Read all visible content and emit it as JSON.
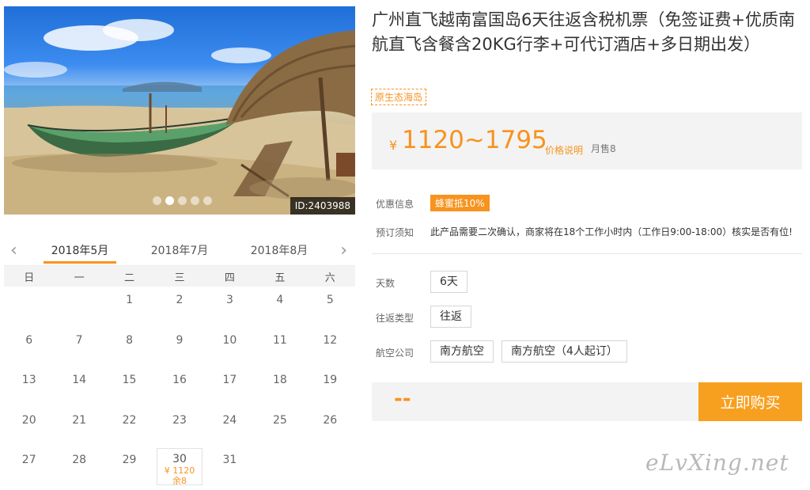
{
  "hero": {
    "id_label": "ID:2403988",
    "slide_count": 5,
    "active_slide": 2
  },
  "calendar": {
    "tabs": [
      "2018年5月",
      "2018年7月",
      "2018年8月"
    ],
    "active_tab": 0,
    "weekdays": [
      "日",
      "一",
      "二",
      "三",
      "四",
      "五",
      "六"
    ],
    "leading_blanks": 2,
    "days": 31,
    "priced_day": {
      "day": "30",
      "price": "¥ 1120",
      "stock": "余8"
    }
  },
  "product": {
    "title": "广州直飞越南富国岛6天往返含税机票（免签证费+优质南航直飞含餐含20KG行李+可代订酒店+多日期出发）",
    "tag": "原生态海岛",
    "price_symbol": "¥",
    "price": "1120~1795",
    "price_note": "价格说明",
    "sold": "月售8"
  },
  "info": {
    "promo_label": "优惠信息",
    "promo_badge": "蜂蜜抵10%",
    "notice_label": "预订须知",
    "notice_text": "此产品需要二次确认，商家将在18个工作小时内（工作日9:00-18:00）核实是否有位!"
  },
  "options": {
    "days_label": "天数",
    "days_value": "6天",
    "trip_label": "往返类型",
    "trip_value": "往返",
    "airline_label": "航空公司",
    "airline_value_1": "南方航空",
    "airline_value_2": "南方航空（4人起订）"
  },
  "buy": {
    "dash": "--",
    "button": "立即购买"
  },
  "watermark": "eLvXing.net"
}
